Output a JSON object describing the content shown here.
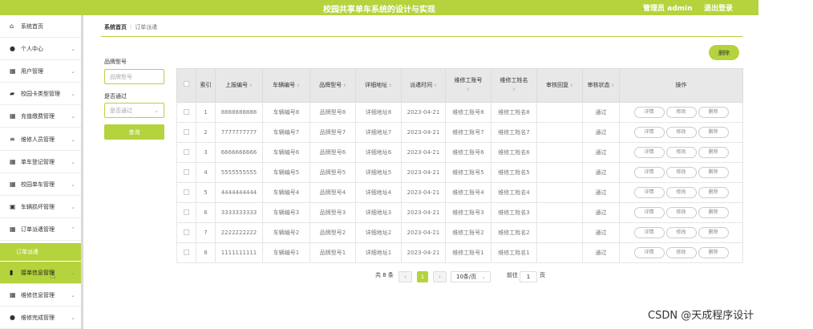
{
  "header": {
    "title": "校园共享单车系统的设计与实现",
    "admin": "管理员 admin",
    "logout": "退出登录"
  },
  "sidebar": {
    "items": [
      {
        "label": "系统首页",
        "icon": "home-icon"
      },
      {
        "label": "个人中心",
        "icon": "user-icon"
      },
      {
        "label": "用户管理",
        "icon": "grid-icon"
      },
      {
        "label": "校园卡类型管理",
        "icon": "card-icon"
      },
      {
        "label": "充值缴费管理",
        "icon": "grid-icon"
      },
      {
        "label": "维修人员管理",
        "icon": "list-icon"
      },
      {
        "label": "单车登记管理",
        "icon": "grid-icon"
      },
      {
        "label": "校园单车管理",
        "icon": "grid-icon"
      },
      {
        "label": "车辆损坏管理",
        "icon": "clipboard-icon"
      },
      {
        "label": "订单派遣管理",
        "icon": "grid-icon"
      },
      {
        "label": "接单信息管理",
        "icon": "chart-icon"
      },
      {
        "label": "维修信息管理",
        "icon": "grid-icon"
      },
      {
        "label": "维修完成管理",
        "icon": "user-icon"
      }
    ],
    "sub_item": "订单派遣"
  },
  "breadcrumb": {
    "home": "系统首页",
    "current": "订单派遣"
  },
  "filters": {
    "brand_label": "品牌型号",
    "brand_placeholder": "品牌型号",
    "pass_label": "是否通过",
    "pass_placeholder": "是否通过",
    "search_button": "查询"
  },
  "delete_button": "删除",
  "table": {
    "headers": [
      "索引",
      "上报编号",
      "车辆编号",
      "品牌型号",
      "详细地址",
      "派遣时间",
      "维修工账号",
      "维修工姓名",
      "审核回复",
      "审核状态",
      "操作"
    ],
    "rows": [
      {
        "idx": "1",
        "report": "8888888888",
        "bike": "车辆编号8",
        "brand": "品牌型号8",
        "addr": "详细地址8",
        "time": "2023-04-21",
        "acct": "维修工账号8",
        "name": "维修工姓名8",
        "reply": "",
        "status": "通过"
      },
      {
        "idx": "2",
        "report": "7777777777",
        "bike": "车辆编号7",
        "brand": "品牌型号7",
        "addr": "详细地址7",
        "time": "2023-04-21",
        "acct": "维修工账号7",
        "name": "维修工姓名7",
        "reply": "",
        "status": "通过"
      },
      {
        "idx": "3",
        "report": "6666666666",
        "bike": "车辆编号6",
        "brand": "品牌型号6",
        "addr": "详细地址6",
        "time": "2023-04-21",
        "acct": "维修工账号6",
        "name": "维修工姓名6",
        "reply": "",
        "status": "通过"
      },
      {
        "idx": "4",
        "report": "5555555555",
        "bike": "车辆编号5",
        "brand": "品牌型号5",
        "addr": "详细地址5",
        "time": "2023-04-21",
        "acct": "维修工账号5",
        "name": "维修工姓名5",
        "reply": "",
        "status": "通过"
      },
      {
        "idx": "5",
        "report": "4444444444",
        "bike": "车辆编号4",
        "brand": "品牌型号4",
        "addr": "详细地址4",
        "time": "2023-04-21",
        "acct": "维修工账号4",
        "name": "维修工姓名4",
        "reply": "",
        "status": "通过"
      },
      {
        "idx": "6",
        "report": "3333333333",
        "bike": "车辆编号3",
        "brand": "品牌型号3",
        "addr": "详细地址3",
        "time": "2023-04-21",
        "acct": "维修工账号3",
        "name": "维修工姓名3",
        "reply": "",
        "status": "通过"
      },
      {
        "idx": "7",
        "report": "2222222222",
        "bike": "车辆编号2",
        "brand": "品牌型号2",
        "addr": "详细地址2",
        "time": "2023-04-21",
        "acct": "维修工账号2",
        "name": "维修工姓名2",
        "reply": "",
        "status": "通过"
      },
      {
        "idx": "8",
        "report": "1111111111",
        "bike": "车辆编号1",
        "brand": "品牌型号1",
        "addr": "详细地址1",
        "time": "2023-04-21",
        "acct": "维修工账号1",
        "name": "维修工姓名1",
        "reply": "",
        "status": "通过"
      }
    ],
    "actions": {
      "detail": "详情",
      "edit": "修改",
      "delete": "删除"
    }
  },
  "pagination": {
    "total": "共 8 条",
    "prev": "‹",
    "current_page": "1",
    "next": "›",
    "page_size": "10条/页",
    "goto_label": "前往",
    "goto_value": "1",
    "page_suffix": "页"
  },
  "watermark": "CSDN @天成程序设计",
  "colors": {
    "accent": "#b5d33d"
  }
}
